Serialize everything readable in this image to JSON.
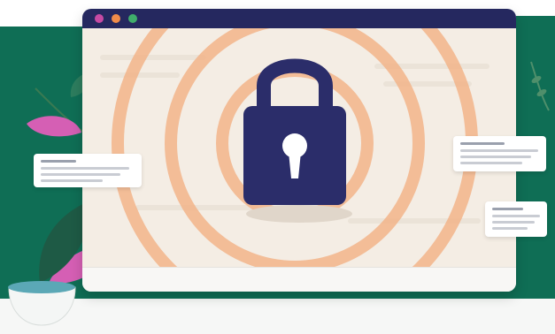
{
  "colors": {
    "brand_green": "#0f6e55",
    "titlebar_navy": "#25285f",
    "lock_navy": "#2b2d6a",
    "ring_orange": "#f2b48a",
    "leaf_pink": "#d55fb4",
    "window_dot_pink": "#c64aa3",
    "window_dot_orange": "#f08c4a",
    "window_dot_green": "#3fae6b"
  },
  "icons": {
    "main": "padlock-icon",
    "keyhole": "keyhole-icon"
  }
}
